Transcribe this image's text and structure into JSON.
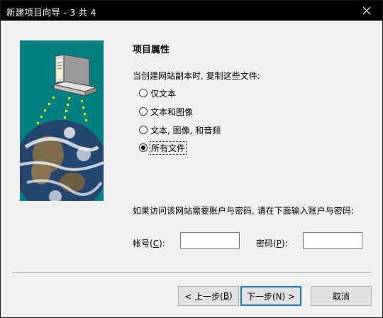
{
  "window": {
    "title": "新建项目向导 - 3 共 4",
    "close_glyph": "✕"
  },
  "page": {
    "heading": "项目属性",
    "prompt": "当创建网站副本时, 复制这些文件:",
    "options": [
      {
        "label": "仅文本",
        "selected": false
      },
      {
        "label": "文本和图像",
        "selected": false
      },
      {
        "label": "文本, 图像, 和音频",
        "selected": false
      },
      {
        "label": "所有文件",
        "selected": true
      }
    ],
    "credentials_prompt": "如果访问该网站需要账户与密码, 请在下面输入账户与密码:",
    "account": {
      "label_pre": "帐号(",
      "label_key": "C",
      "label_post": "):",
      "value": ""
    },
    "password": {
      "label_pre": "密码(",
      "label_key": "P",
      "label_post": "):",
      "value": ""
    }
  },
  "buttons": {
    "back": {
      "pre": "< 上一步(",
      "key": "B",
      "post": ")"
    },
    "next": "下一步(N) >",
    "cancel": "取消"
  },
  "colors": {
    "illustration_bg": "#008080",
    "default_button_border": "#0078d7"
  },
  "icons": [
    "computer-icon",
    "earth-globe-icon",
    "close-icon"
  ]
}
